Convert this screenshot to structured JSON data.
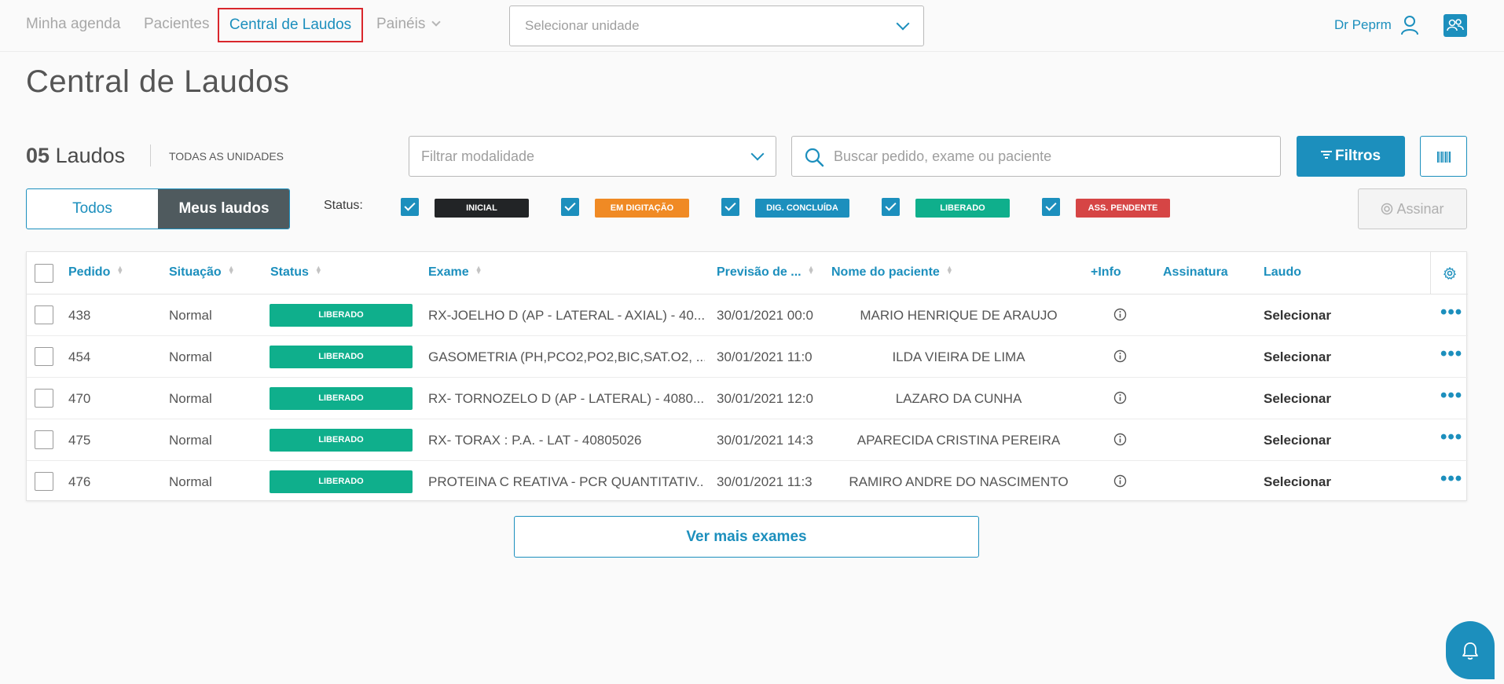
{
  "nav": {
    "items": [
      "Minha agenda",
      "Pacientes",
      "Central de Laudos",
      "Painéis"
    ],
    "unidade_placeholder": "Selecionar unidade",
    "user_name": "Dr Peprm"
  },
  "page": {
    "title": "Central de Laudos"
  },
  "summary": {
    "count": "05",
    "count_label": "Laudos",
    "unidades": "TODAS AS UNIDADES"
  },
  "filters": {
    "modalidade_placeholder": "Filtrar modalidade",
    "search_placeholder": "Buscar pedido, exame ou paciente",
    "filtros_label": "Filtros",
    "segment": [
      "Todos",
      "Meus laudos"
    ],
    "status_label": "Status:",
    "status_tags": [
      {
        "label": "INICIAL",
        "color": "#222426"
      },
      {
        "label": "EM DIGITAÇÃO",
        "color": "#f08a24"
      },
      {
        "label": "DIG. CONCLUÍDA",
        "color": "#1c8fbd"
      },
      {
        "label": "LIBERADO",
        "color": "#0faf8c"
      },
      {
        "label": "ASS. PENDENTE",
        "color": "#d64545"
      }
    ],
    "assinar_label": "Assinar"
  },
  "table": {
    "headers": [
      "Pedido",
      "Situação",
      "Status",
      "Exame",
      "Previsão de ...",
      "Nome do paciente",
      "+Info",
      "Assinatura",
      "Laudo"
    ],
    "rows": [
      {
        "pedido": "438",
        "situacao": "Normal",
        "status": "LIBERADO",
        "exame": "RX-JOELHO D (AP - LATERAL - AXIAL) - 40...",
        "previsao": "30/01/2021 00:0",
        "paciente": "MARIO HENRIQUE DE ARAUJO",
        "laudo": "Selecionar"
      },
      {
        "pedido": "454",
        "situacao": "Normal",
        "status": "LIBERADO",
        "exame": "GASOMETRIA (PH,PCO2,PO2,BIC,SAT.O2, ...",
        "previsao": "30/01/2021 11:0",
        "paciente": "ILDA VIEIRA DE LIMA",
        "laudo": "Selecionar"
      },
      {
        "pedido": "470",
        "situacao": "Normal",
        "status": "LIBERADO",
        "exame": "RX- TORNOZELO D (AP - LATERAL) - 4080...",
        "previsao": "30/01/2021 12:0",
        "paciente": "LAZARO DA CUNHA",
        "laudo": "Selecionar"
      },
      {
        "pedido": "475",
        "situacao": "Normal",
        "status": "LIBERADO",
        "exame": "RX- TORAX : P.A. - LAT - 40805026",
        "previsao": "30/01/2021 14:3",
        "paciente": "APARECIDA CRISTINA PEREIRA",
        "laudo": "Selecionar"
      },
      {
        "pedido": "476",
        "situacao": "Normal",
        "status": "LIBERADO",
        "exame": "PROTEINA C REATIVA - PCR QUANTITATIV...",
        "previsao": "30/01/2021 11:3",
        "paciente": "RAMIRO ANDRE DO NASCIMENTO",
        "laudo": "Selecionar"
      }
    ]
  },
  "footer": {
    "ver_mais": "Ver mais exames"
  },
  "colors": {
    "accent": "#1c8fbd",
    "liberado": "#0faf8c",
    "active_outline": "#d9262c"
  }
}
